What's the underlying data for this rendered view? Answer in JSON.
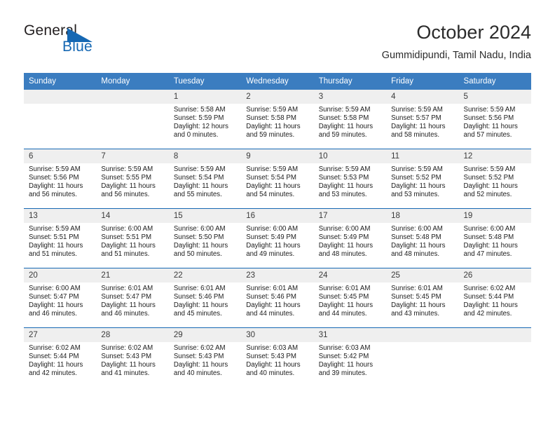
{
  "brand": {
    "name_part1": "General",
    "name_part2": "Blue",
    "accent_color": "#1668b3"
  },
  "header": {
    "title": "October 2024",
    "subtitle": "Gummidipundi, Tamil Nadu, India"
  },
  "calendar": {
    "header_bg": "#3b7dc0",
    "row_divider_color": "#1668b3",
    "daynum_bg": "#efefef",
    "weekdays": [
      "Sunday",
      "Monday",
      "Tuesday",
      "Wednesday",
      "Thursday",
      "Friday",
      "Saturday"
    ],
    "weeks": [
      [
        {
          "day": "",
          "lines": []
        },
        {
          "day": "",
          "lines": []
        },
        {
          "day": "1",
          "lines": [
            "Sunrise: 5:58 AM",
            "Sunset: 5:59 PM",
            "Daylight: 12 hours",
            "and 0 minutes."
          ]
        },
        {
          "day": "2",
          "lines": [
            "Sunrise: 5:59 AM",
            "Sunset: 5:58 PM",
            "Daylight: 11 hours",
            "and 59 minutes."
          ]
        },
        {
          "day": "3",
          "lines": [
            "Sunrise: 5:59 AM",
            "Sunset: 5:58 PM",
            "Daylight: 11 hours",
            "and 59 minutes."
          ]
        },
        {
          "day": "4",
          "lines": [
            "Sunrise: 5:59 AM",
            "Sunset: 5:57 PM",
            "Daylight: 11 hours",
            "and 58 minutes."
          ]
        },
        {
          "day": "5",
          "lines": [
            "Sunrise: 5:59 AM",
            "Sunset: 5:56 PM",
            "Daylight: 11 hours",
            "and 57 minutes."
          ]
        }
      ],
      [
        {
          "day": "6",
          "lines": [
            "Sunrise: 5:59 AM",
            "Sunset: 5:56 PM",
            "Daylight: 11 hours",
            "and 56 minutes."
          ]
        },
        {
          "day": "7",
          "lines": [
            "Sunrise: 5:59 AM",
            "Sunset: 5:55 PM",
            "Daylight: 11 hours",
            "and 56 minutes."
          ]
        },
        {
          "day": "8",
          "lines": [
            "Sunrise: 5:59 AM",
            "Sunset: 5:54 PM",
            "Daylight: 11 hours",
            "and 55 minutes."
          ]
        },
        {
          "day": "9",
          "lines": [
            "Sunrise: 5:59 AM",
            "Sunset: 5:54 PM",
            "Daylight: 11 hours",
            "and 54 minutes."
          ]
        },
        {
          "day": "10",
          "lines": [
            "Sunrise: 5:59 AM",
            "Sunset: 5:53 PM",
            "Daylight: 11 hours",
            "and 53 minutes."
          ]
        },
        {
          "day": "11",
          "lines": [
            "Sunrise: 5:59 AM",
            "Sunset: 5:52 PM",
            "Daylight: 11 hours",
            "and 53 minutes."
          ]
        },
        {
          "day": "12",
          "lines": [
            "Sunrise: 5:59 AM",
            "Sunset: 5:52 PM",
            "Daylight: 11 hours",
            "and 52 minutes."
          ]
        }
      ],
      [
        {
          "day": "13",
          "lines": [
            "Sunrise: 5:59 AM",
            "Sunset: 5:51 PM",
            "Daylight: 11 hours",
            "and 51 minutes."
          ]
        },
        {
          "day": "14",
          "lines": [
            "Sunrise: 6:00 AM",
            "Sunset: 5:51 PM",
            "Daylight: 11 hours",
            "and 51 minutes."
          ]
        },
        {
          "day": "15",
          "lines": [
            "Sunrise: 6:00 AM",
            "Sunset: 5:50 PM",
            "Daylight: 11 hours",
            "and 50 minutes."
          ]
        },
        {
          "day": "16",
          "lines": [
            "Sunrise: 6:00 AM",
            "Sunset: 5:49 PM",
            "Daylight: 11 hours",
            "and 49 minutes."
          ]
        },
        {
          "day": "17",
          "lines": [
            "Sunrise: 6:00 AM",
            "Sunset: 5:49 PM",
            "Daylight: 11 hours",
            "and 48 minutes."
          ]
        },
        {
          "day": "18",
          "lines": [
            "Sunrise: 6:00 AM",
            "Sunset: 5:48 PM",
            "Daylight: 11 hours",
            "and 48 minutes."
          ]
        },
        {
          "day": "19",
          "lines": [
            "Sunrise: 6:00 AM",
            "Sunset: 5:48 PM",
            "Daylight: 11 hours",
            "and 47 minutes."
          ]
        }
      ],
      [
        {
          "day": "20",
          "lines": [
            "Sunrise: 6:00 AM",
            "Sunset: 5:47 PM",
            "Daylight: 11 hours",
            "and 46 minutes."
          ]
        },
        {
          "day": "21",
          "lines": [
            "Sunrise: 6:01 AM",
            "Sunset: 5:47 PM",
            "Daylight: 11 hours",
            "and 46 minutes."
          ]
        },
        {
          "day": "22",
          "lines": [
            "Sunrise: 6:01 AM",
            "Sunset: 5:46 PM",
            "Daylight: 11 hours",
            "and 45 minutes."
          ]
        },
        {
          "day": "23",
          "lines": [
            "Sunrise: 6:01 AM",
            "Sunset: 5:46 PM",
            "Daylight: 11 hours",
            "and 44 minutes."
          ]
        },
        {
          "day": "24",
          "lines": [
            "Sunrise: 6:01 AM",
            "Sunset: 5:45 PM",
            "Daylight: 11 hours",
            "and 44 minutes."
          ]
        },
        {
          "day": "25",
          "lines": [
            "Sunrise: 6:01 AM",
            "Sunset: 5:45 PM",
            "Daylight: 11 hours",
            "and 43 minutes."
          ]
        },
        {
          "day": "26",
          "lines": [
            "Sunrise: 6:02 AM",
            "Sunset: 5:44 PM",
            "Daylight: 11 hours",
            "and 42 minutes."
          ]
        }
      ],
      [
        {
          "day": "27",
          "lines": [
            "Sunrise: 6:02 AM",
            "Sunset: 5:44 PM",
            "Daylight: 11 hours",
            "and 42 minutes."
          ]
        },
        {
          "day": "28",
          "lines": [
            "Sunrise: 6:02 AM",
            "Sunset: 5:43 PM",
            "Daylight: 11 hours",
            "and 41 minutes."
          ]
        },
        {
          "day": "29",
          "lines": [
            "Sunrise: 6:02 AM",
            "Sunset: 5:43 PM",
            "Daylight: 11 hours",
            "and 40 minutes."
          ]
        },
        {
          "day": "30",
          "lines": [
            "Sunrise: 6:03 AM",
            "Sunset: 5:43 PM",
            "Daylight: 11 hours",
            "and 40 minutes."
          ]
        },
        {
          "day": "31",
          "lines": [
            "Sunrise: 6:03 AM",
            "Sunset: 5:42 PM",
            "Daylight: 11 hours",
            "and 39 minutes."
          ]
        },
        {
          "day": "",
          "lines": []
        },
        {
          "day": "",
          "lines": []
        }
      ]
    ]
  }
}
